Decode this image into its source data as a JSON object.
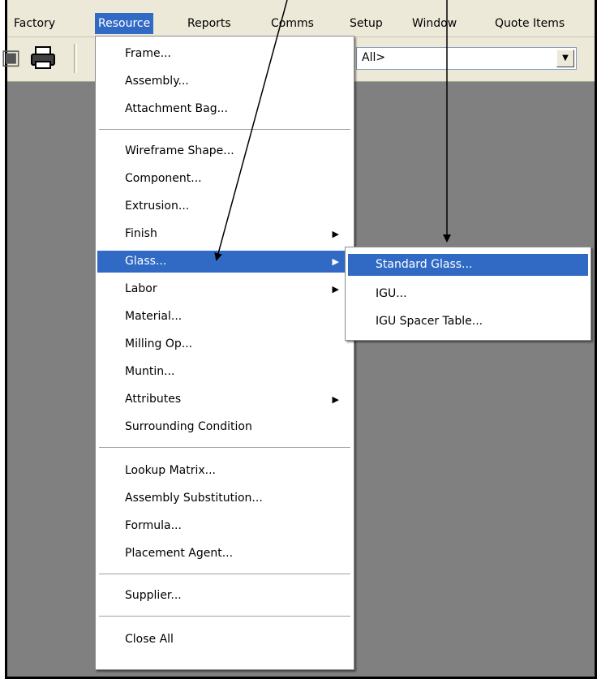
{
  "menubar": {
    "items": [
      {
        "label": "Factory"
      },
      {
        "label": "Resource"
      },
      {
        "label": "Reports"
      },
      {
        "label": "Comms"
      },
      {
        "label": "Setup"
      },
      {
        "label": "Window"
      },
      {
        "label": "Quote Items"
      }
    ],
    "active": "Resource"
  },
  "toolbar": {
    "combo_value": "All>"
  },
  "resource_menu": {
    "items": [
      {
        "label": "Frame..."
      },
      {
        "label": "Assembly..."
      },
      {
        "label": "Attachment Bag..."
      },
      {
        "label": "Wireframe Shape..."
      },
      {
        "label": "Component..."
      },
      {
        "label": "Extrusion..."
      },
      {
        "label": "Finish"
      },
      {
        "label": "Glass..."
      },
      {
        "label": "Labor"
      },
      {
        "label": "Material..."
      },
      {
        "label": "Milling Op..."
      },
      {
        "label": "Muntin..."
      },
      {
        "label": "Attributes"
      },
      {
        "label": "Surrounding Condition"
      },
      {
        "label": "Lookup Matrix..."
      },
      {
        "label": "Assembly Substitution..."
      },
      {
        "label": "Formula..."
      },
      {
        "label": "Placement Agent..."
      },
      {
        "label": "Supplier..."
      },
      {
        "label": "Close All"
      }
    ]
  },
  "glass_submenu": {
    "items": [
      {
        "label": "Standard Glass..."
      },
      {
        "label": "IGU..."
      },
      {
        "label": "IGU Spacer Table..."
      }
    ]
  },
  "icons": {
    "save": "save-icon",
    "print": "printer-icon",
    "submenu_arrow": "▶",
    "combo_arrow": "▼"
  },
  "colors": {
    "highlight": "#316ac5",
    "menubar_bg": "#ece9d8",
    "workspace_bg": "#808080"
  }
}
